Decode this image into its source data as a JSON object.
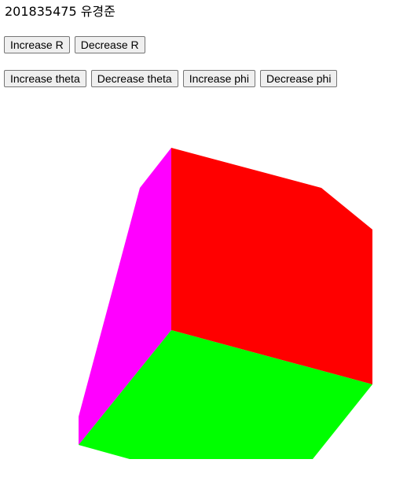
{
  "header": {
    "title": "201835475 유경준"
  },
  "controls": {
    "increase_r": "Increase R",
    "decrease_r": "Decrease R",
    "increase_theta": "Increase theta",
    "decrease_theta": "Decrease theta",
    "increase_phi": "Increase phi",
    "decrease_phi": "Decrease phi"
  },
  "cube": {
    "faces": [
      {
        "name": "red-face",
        "color": "#ff0000"
      },
      {
        "name": "magenta-face",
        "color": "#ff00ff"
      },
      {
        "name": "green-face",
        "color": "#00ff00"
      }
    ]
  }
}
